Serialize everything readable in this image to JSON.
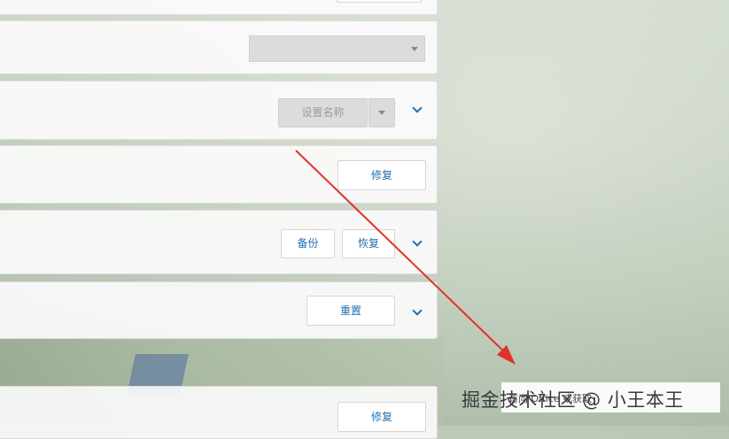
{
  "rows": {
    "name_selector": {
      "value": "设置名称"
    },
    "repair_1": {
      "button": "修复"
    },
    "backup_restore": {
      "backup": "备份",
      "restore": "恢复"
    },
    "reset": {
      "button": "重置"
    },
    "repair_2": {
      "button": "修复"
    }
  },
  "watermark": {
    "line_small": "访问 Office 或获取",
    "line_big": "掘金技术社区 @ 小王本王"
  },
  "annotation": {
    "arrow_color": "#e0322b"
  },
  "colors": {
    "accent": "#1f6fb2"
  }
}
